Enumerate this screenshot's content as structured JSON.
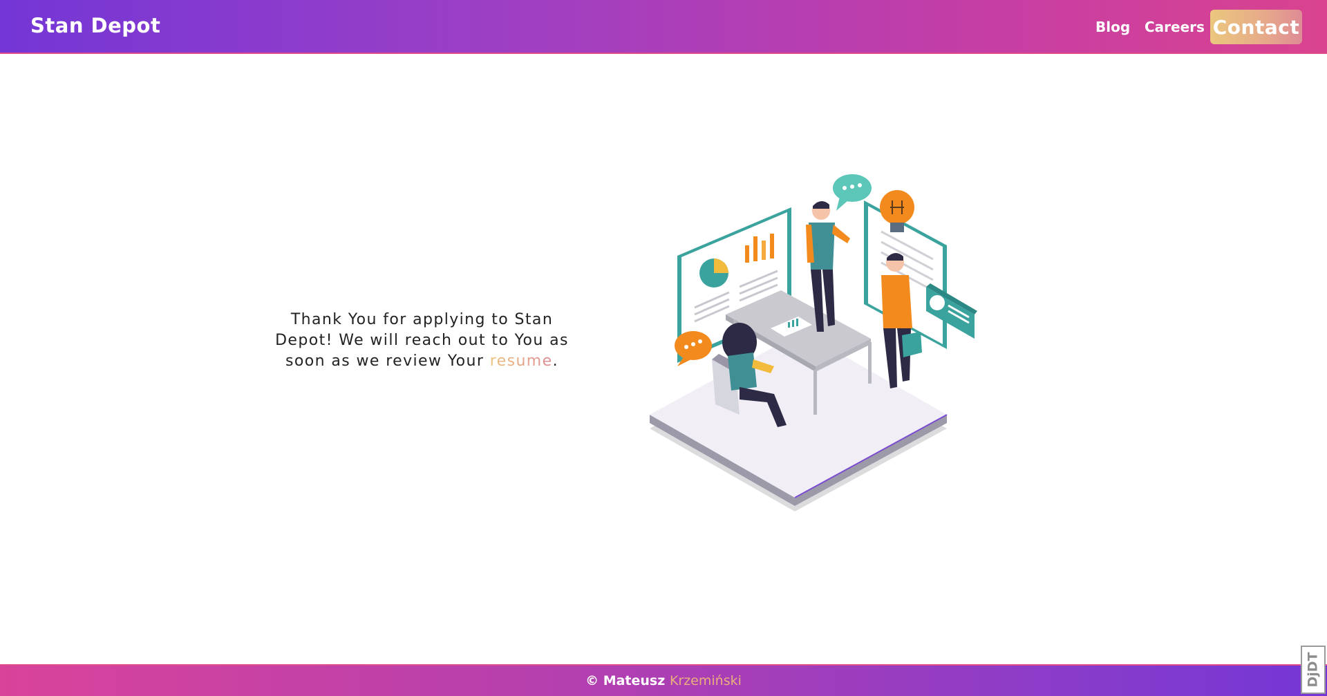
{
  "header": {
    "brand": "Stan Depot",
    "nav": {
      "blog": "Blog",
      "careers": "Careers",
      "contact": "Contact"
    }
  },
  "main": {
    "message_part1": "Thank You for applying to Stan Depot! We will reach out to You as soon as we review Your ",
    "resume_link": "resume",
    "message_end": "."
  },
  "illustration": {
    "icon": "team-meeting-isometric-illustration",
    "colors": {
      "teal": "#3aa39e",
      "orange": "#f28a1e",
      "navy": "#2d2a45",
      "grey": "#c9c9cf"
    }
  },
  "footer": {
    "copyright_name": "© Mateusz",
    "copyright_surname": "Krzemiński"
  },
  "corner_badge": {
    "text": "DjDT"
  },
  "colors": {
    "header_gradient_start": "#7436d6",
    "header_gradient_end": "#d9438f",
    "accent_gold": "#ebc77e",
    "accent_pink": "#de8b95"
  }
}
